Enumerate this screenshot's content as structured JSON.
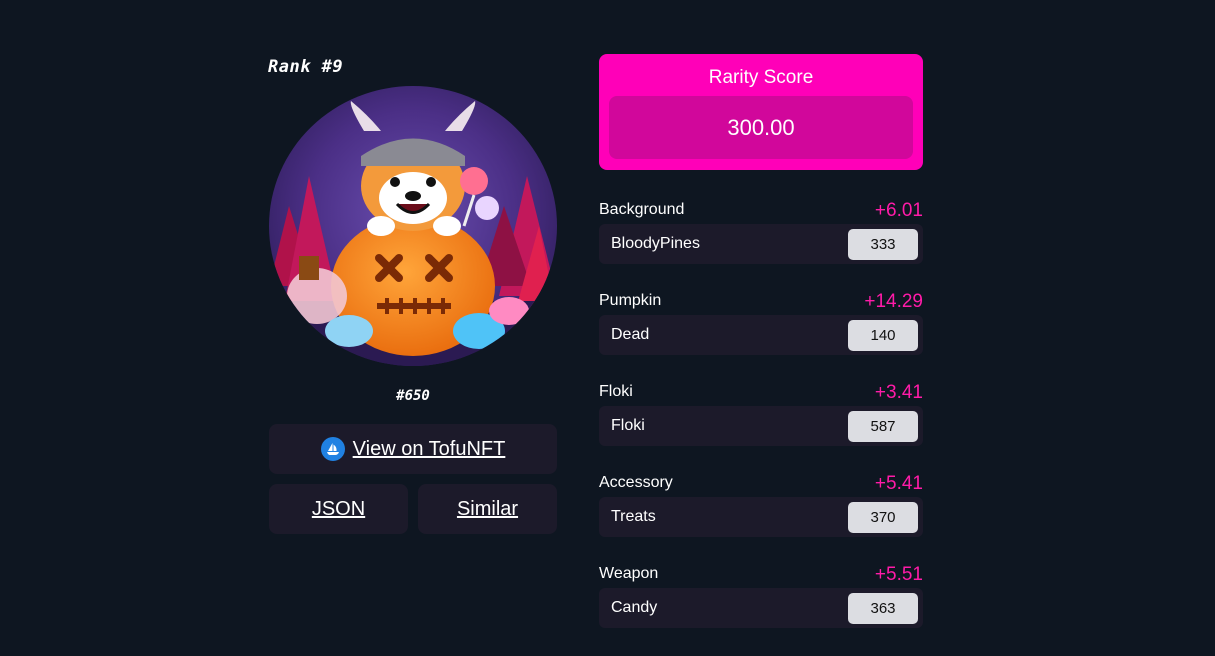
{
  "left": {
    "rank_label": "Rank  #9",
    "token_id": "#650",
    "tofu_button": "View on TofuNFT",
    "json_button": "JSON",
    "similar_button": "Similar",
    "image_icon": "floki-halloween-pumpkin-image",
    "marketplace_icon": "ship-icon"
  },
  "score": {
    "title": "Rarity Score",
    "value": "300.00"
  },
  "traits": [
    {
      "name": "Background",
      "score": "+6.01",
      "value": "BloodyPines",
      "count": "333"
    },
    {
      "name": "Pumpkin",
      "score": "+14.29",
      "value": "Dead",
      "count": "140"
    },
    {
      "name": "Floki",
      "score": "+3.41",
      "value": "Floki",
      "count": "587"
    },
    {
      "name": "Accessory",
      "score": "+5.41",
      "value": "Treats",
      "count": "370"
    },
    {
      "name": "Weapon",
      "score": "+5.51",
      "value": "Candy",
      "count": "363"
    }
  ],
  "colors": {
    "page_bg": "#0e1621",
    "accent": "#ff00b8",
    "score_inner": "#d1079b",
    "trait_score": "#ff1ba8",
    "panel": "#1c1a2a",
    "badge": "#dcdde2"
  }
}
